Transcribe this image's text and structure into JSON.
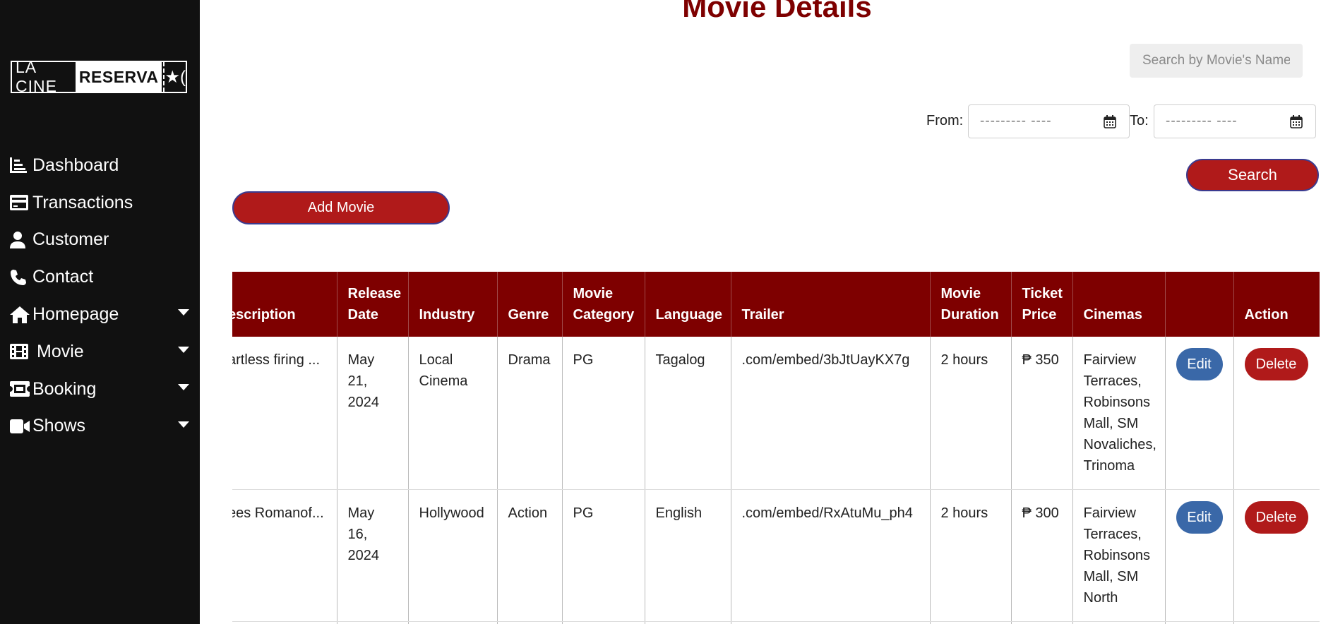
{
  "sidebar": {
    "logo": {
      "part1": "LA CINE",
      "part2": "RESERVA",
      "part3": "★("
    },
    "items": [
      {
        "label": "Dashboard",
        "icon": "chart-icon",
        "dropdown": false
      },
      {
        "label": "Transactions",
        "icon": "credit-card-icon",
        "dropdown": false
      },
      {
        "label": "Customer",
        "icon": "user-icon",
        "dropdown": false
      },
      {
        "label": "Contact",
        "icon": "phone-icon",
        "dropdown": false
      },
      {
        "label": "Homepage",
        "icon": "home-icon",
        "dropdown": true
      },
      {
        "label": "Movie",
        "icon": "film-icon",
        "dropdown": true
      },
      {
        "label": "Booking",
        "icon": "ticket-icon",
        "dropdown": true
      },
      {
        "label": "Shows",
        "icon": "video-icon",
        "dropdown": true
      }
    ]
  },
  "main": {
    "title": "Movie Details",
    "search": {
      "placeholder": "Search by Movie's Name"
    },
    "from_label": "From:",
    "to_label": "To:",
    "date_placeholder": "--------- ----",
    "search_button": "Search",
    "add_button": "Add Movie"
  },
  "table": {
    "headers": [
      "escription",
      "Release Date",
      "Industry",
      "Genre",
      "Movie Category",
      "Language",
      "Trailer",
      "Movie Duration",
      "Ticket Price",
      "Cinemas",
      "",
      "Action"
    ],
    "rows": [
      {
        "description": "artless firing ...",
        "release_date": "May 21, 2024",
        "industry": "Local Cinema",
        "genre": "Drama",
        "category": "PG",
        "language": "Tagalog",
        "trailer": ".com/embed/3bJtUayKX7g",
        "duration": "2 hours",
        "price": "₱ 350",
        "cinemas": "Fairview Terraces, Robinsons Mall, SM Novaliches, Trinoma",
        "edit": "Edit",
        "delete": "Delete"
      },
      {
        "description": "ees Romanof...",
        "release_date": "May 16, 2024",
        "industry": "Hollywood",
        "genre": "Action",
        "category": "PG",
        "language": "English",
        "trailer": ".com/embed/RxAtuMu_ph4",
        "duration": "2 hours",
        "price": "₱ 300",
        "cinemas": "Fairview Terraces, Robinsons Mall, SM North",
        "edit": "Edit",
        "delete": "Delete"
      }
    ]
  },
  "colors": {
    "sidebar_bg": "#111111",
    "title": "#7e0000",
    "header_bg": "#7e0000",
    "primary_button": "#b01a1a",
    "edit_button": "#3a68a8"
  }
}
